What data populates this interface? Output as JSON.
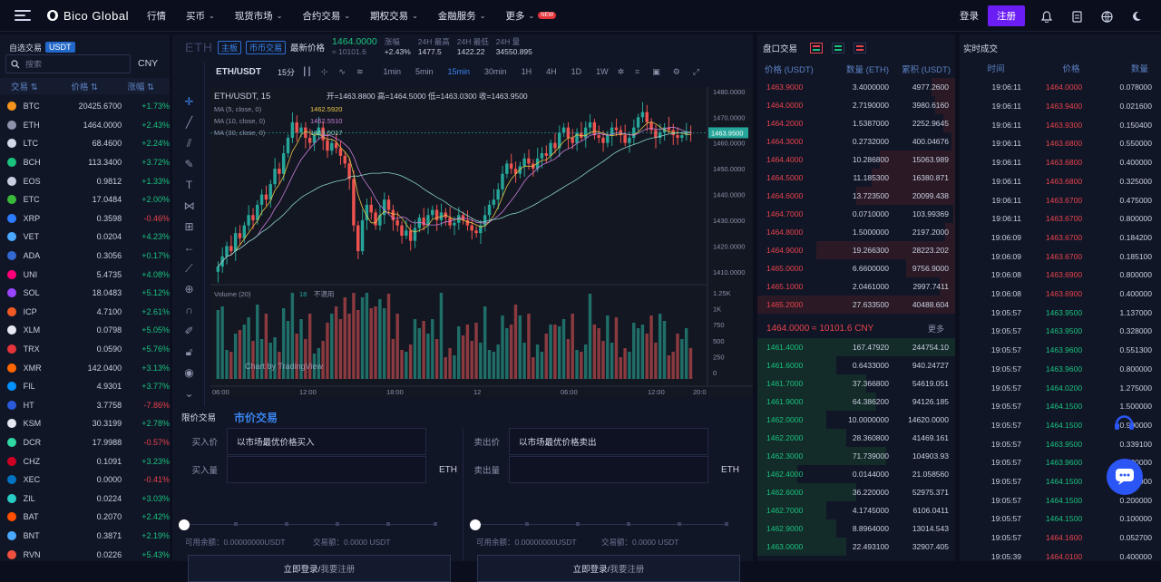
{
  "header": {
    "brand": "Bico Global",
    "nav": [
      {
        "label": "行情",
        "arrow": false,
        "new": false
      },
      {
        "label": "买币",
        "arrow": true,
        "new": false
      },
      {
        "label": "现货市场",
        "arrow": true,
        "new": false
      },
      {
        "label": "合约交易",
        "arrow": true,
        "new": false
      },
      {
        "label": "期权交易",
        "arrow": true,
        "new": false
      },
      {
        "label": "金融服务",
        "arrow": true,
        "new": false
      },
      {
        "label": "更多",
        "arrow": true,
        "new": true
      }
    ],
    "new_badge": "NEW",
    "login": "登录",
    "register": "注册"
  },
  "market": {
    "title": "自选交易",
    "tab": "USDT",
    "search_placeholder": "搜索",
    "currency": "CNY",
    "col_pair": "交易",
    "col_price": "价格",
    "col_change": "涨幅",
    "coins": [
      {
        "name": "BTC",
        "price": "20425.6700",
        "change": "+1.73%",
        "color": "#f7931a"
      },
      {
        "name": "ETH",
        "price": "1464.0000",
        "change": "+2.43%",
        "color": "#8c93ab"
      },
      {
        "name": "LTC",
        "price": "68.4600",
        "change": "+2.24%",
        "color": "#d3d9e9"
      },
      {
        "name": "BCH",
        "price": "113.3400",
        "change": "+3.72%",
        "color": "#19c37d"
      },
      {
        "name": "EOS",
        "price": "0.9812",
        "change": "+1.33%",
        "color": "#c9cfe0"
      },
      {
        "name": "ETC",
        "price": "17.0484",
        "change": "+2.00%",
        "color": "#3ab83a"
      },
      {
        "name": "XRP",
        "price": "0.3598",
        "change": "-0.46%",
        "color": "#2b7cff"
      },
      {
        "name": "VET",
        "price": "0.0204",
        "change": "+4.23%",
        "color": "#4aa8ff"
      },
      {
        "name": "ADA",
        "price": "0.3056",
        "change": "+0.17%",
        "color": "#3468d1"
      },
      {
        "name": "UNI",
        "price": "5.4735",
        "change": "+4.08%",
        "color": "#ff007a"
      },
      {
        "name": "SOL",
        "price": "18.0483",
        "change": "+5.12%",
        "color": "#9945ff"
      },
      {
        "name": "ICP",
        "price": "4.7100",
        "change": "+2.61%",
        "color": "#f15a24"
      },
      {
        "name": "XLM",
        "price": "0.0798",
        "change": "+5.05%",
        "color": "#e6e9f2"
      },
      {
        "name": "TRX",
        "price": "0.0590",
        "change": "+5.76%",
        "color": "#e5353a"
      },
      {
        "name": "XMR",
        "price": "142.0400",
        "change": "+3.13%",
        "color": "#ff6600"
      },
      {
        "name": "FIL",
        "price": "4.9301",
        "change": "+3.77%",
        "color": "#0090ff"
      },
      {
        "name": "HT",
        "price": "3.7758",
        "change": "-7.86%",
        "color": "#2a5ada"
      },
      {
        "name": "KSM",
        "price": "30.3199",
        "change": "+2.78%",
        "color": "#e6e9f2"
      },
      {
        "name": "DCR",
        "price": "17.9988",
        "change": "-0.57%",
        "color": "#2ed8a3"
      },
      {
        "name": "CHZ",
        "price": "0.1091",
        "change": "+3.23%",
        "color": "#cd0124"
      },
      {
        "name": "XEC",
        "price": "0.0000",
        "change": "-0.41%",
        "color": "#0074c2"
      },
      {
        "name": "ZIL",
        "price": "0.0224",
        "change": "+3.03%",
        "color": "#29ccc4"
      },
      {
        "name": "BAT",
        "price": "0.2070",
        "change": "+2.42%",
        "color": "#ff5000"
      },
      {
        "name": "BNT",
        "price": "0.3871",
        "change": "+2.19%",
        "color": "#4aa8ff"
      },
      {
        "name": "RVN",
        "price": "0.0226",
        "change": "+5.43%",
        "color": "#f0503e"
      }
    ]
  },
  "ticker": {
    "symbol": "ETH",
    "main_btn": "主板",
    "pair_btn": "币币交易",
    "latest_label": "最新价格",
    "latest_price": "1464.0000",
    "latest_cny": "≈ 10101.6",
    "change_label": "涨幅",
    "change": "+2.43%",
    "high_label": "24H 最高",
    "high": "1477.5",
    "low_label": "24H 最低",
    "low": "1422.22",
    "vol_label": "24H 量",
    "vol": "34550.895"
  },
  "chart_toolbar": {
    "pair": "ETH/USDT",
    "interval": "15分",
    "timeframes": [
      "1min",
      "5min",
      "15min",
      "30min",
      "1H",
      "4H",
      "1D",
      "1W"
    ],
    "active_timeframe": "15min"
  },
  "chart_data": {
    "type": "candlestick",
    "legend_pair": "ETH/USDT, 15",
    "ohlc": {
      "open": "开=1463.8800",
      "high": "高=1464.5000",
      "low": "低=1463.0300",
      "close": "收=1463.9500"
    },
    "ma_labels": [
      {
        "label": "MA (5, close, 0)",
        "value": "1462.5920",
        "color": "#e8c547"
      },
      {
        "label": "MA (10, close, 0)",
        "value": "1462.5510",
        "color": "#c77dd9"
      },
      {
        "label": "MA (30, close, 0)",
        "value": "1463.5017",
        "color": "#8ad4c6"
      }
    ],
    "current_price": "1463.9500",
    "y_ticks": [
      "1480.0000",
      "1470.0000",
      "1460.0000",
      "1450.0000",
      "1440.0000",
      "1430.0000",
      "1420.0000",
      "1410.0000"
    ],
    "ylim": [
      1405,
      1481
    ],
    "x_ticks": [
      "06:00",
      "12:00",
      "18:00",
      "12",
      "06:00",
      "12:00",
      "20:0"
    ],
    "volume_label": "Volume (20)",
    "volume_value": "18",
    "volume_na": "不適用",
    "vol_ticks": [
      "1.25K",
      "1K",
      "750",
      "500",
      "250",
      "0"
    ],
    "watermark": "Chart by TradingView",
    "closes": [
      1412,
      1416,
      1420,
      1418,
      1425,
      1423,
      1428,
      1432,
      1430,
      1436,
      1440,
      1438,
      1444,
      1450,
      1448,
      1456,
      1462,
      1468,
      1464,
      1466,
      1462,
      1460,
      1463,
      1466,
      1461,
      1457,
      1460,
      1458,
      1455,
      1452,
      1446,
      1428,
      1418,
      1430,
      1436,
      1433,
      1428,
      1432,
      1438,
      1434,
      1430,
      1428,
      1424,
      1426,
      1422,
      1427,
      1431,
      1428,
      1432,
      1434,
      1430,
      1433,
      1431,
      1428,
      1429,
      1432,
      1430,
      1428,
      1426,
      1425,
      1428,
      1432,
      1436,
      1438,
      1442,
      1448,
      1452,
      1450,
      1448,
      1451,
      1454,
      1452,
      1450,
      1454,
      1456,
      1455,
      1460,
      1458,
      1464,
      1466,
      1462,
      1460,
      1464,
      1462,
      1466,
      1468,
      1463,
      1462,
      1460,
      1463,
      1466,
      1465,
      1463,
      1460,
      1462,
      1466,
      1470,
      1472,
      1468,
      1465,
      1462,
      1464,
      1466,
      1465,
      1463,
      1462,
      1463,
      1464,
      1463.95
    ]
  },
  "order_form": {
    "tab_limit": "限价交易",
    "tab_market": "市价交易",
    "buy_price_label": "买入价",
    "buy_price_value": "以市场最优价格买入",
    "buy_qty_label": "买入量",
    "sell_price_label": "卖出价",
    "sell_price_value": "以市场最优价格卖出",
    "sell_qty_label": "卖出量",
    "unit": "ETH",
    "available": "可用余额：0.00000000USDT",
    "volume": "交易额：0.0000 USDT",
    "login_text": "立即登录/",
    "register_text": " 我要注册"
  },
  "orderbook": {
    "title": "盘口交易",
    "col_price": "价格 (USDT)",
    "col_amount": "数量 (ETH)",
    "col_total": "累积 (USDT)",
    "asks": [
      {
        "p": "1463.9000",
        "a": "3.4000000",
        "s": "4977.2600",
        "d": 0.12
      },
      {
        "p": "1464.0000",
        "a": "2.7190000",
        "s": "3980.6160",
        "d": 0.1
      },
      {
        "p": "1464.2000",
        "a": "1.5387000",
        "s": "2252.9645",
        "d": 0.06
      },
      {
        "p": "1464.3000",
        "a": "0.2732000",
        "s": "400.04676",
        "d": 0.02
      },
      {
        "p": "1464.4000",
        "a": "10.286800",
        "s": "15063.989",
        "d": 0.38
      },
      {
        "p": "1464.5000",
        "a": "11.185300",
        "s": "16380.871",
        "d": 0.42
      },
      {
        "p": "1464.6000",
        "a": "13.723500",
        "s": "20099.438",
        "d": 0.5
      },
      {
        "p": "1464.7000",
        "a": "0.0710000",
        "s": "103.99369",
        "d": 0.01
      },
      {
        "p": "1464.8000",
        "a": "1.5000000",
        "s": "2197.2000",
        "d": 0.05
      },
      {
        "p": "1464.9000",
        "a": "19.266300",
        "s": "28223.202",
        "d": 0.7
      },
      {
        "p": "1465.0000",
        "a": "6.6600000",
        "s": "9756.9000",
        "d": 0.25
      },
      {
        "p": "1465.1000",
        "a": "2.0461000",
        "s": "2997.7411",
        "d": 0.08
      },
      {
        "p": "1465.2000",
        "a": "27.633500",
        "s": "40488.604",
        "d": 1.0
      }
    ],
    "mid_price": "1464.0000 ≈ 10101.6 CNY",
    "more": "更多",
    "bids": [
      {
        "p": "1461.4000",
        "a": "167.47920",
        "s": "244754.10",
        "d": 1.0
      },
      {
        "p": "1461.6000",
        "a": "0.6433000",
        "s": "940.24727",
        "d": 0.4
      },
      {
        "p": "1461.7000",
        "a": "37.366800",
        "s": "54619.051",
        "d": 0.55
      },
      {
        "p": "1461.9000",
        "a": "64.386200",
        "s": "94126.185",
        "d": 0.6
      },
      {
        "p": "1462.0000",
        "a": "10.0000000",
        "s": "14620.0000",
        "d": 0.35
      },
      {
        "p": "1462.2000",
        "a": "28.360800",
        "s": "41469.161",
        "d": 0.45
      },
      {
        "p": "1462.3000",
        "a": "71.739000",
        "s": "104903.93",
        "d": 0.65
      },
      {
        "p": "1462.4000",
        "a": "0.0144000",
        "s": "21.058560",
        "d": 0.2
      },
      {
        "p": "1462.6000",
        "a": "36.220000",
        "s": "52975.371",
        "d": 0.5
      },
      {
        "p": "1462.7000",
        "a": "4.1745000",
        "s": "6106.0411",
        "d": 0.35
      },
      {
        "p": "1462.9000",
        "a": "8.8964000",
        "s": "13014.543",
        "d": 0.4
      },
      {
        "p": "1463.0000",
        "a": "22.493100",
        "s": "32907.405",
        "d": 0.45
      }
    ]
  },
  "trades": {
    "title": "实时成交",
    "col_time": "时间",
    "col_price": "价格",
    "col_amount": "数量",
    "rows": [
      {
        "t": "19:06:11",
        "p": "1464.0000",
        "a": "0.078000",
        "side": "dn"
      },
      {
        "t": "19:06:11",
        "p": "1463.9400",
        "a": "0.021600",
        "side": "dn"
      },
      {
        "t": "19:06:11",
        "p": "1463.9300",
        "a": "0.150400",
        "side": "dn"
      },
      {
        "t": "19:06:11",
        "p": "1463.6800",
        "a": "0.550000",
        "side": "dn"
      },
      {
        "t": "19:06:11",
        "p": "1463.6800",
        "a": "0.400000",
        "side": "dn"
      },
      {
        "t": "19:06:11",
        "p": "1463.6800",
        "a": "0.325000",
        "side": "dn"
      },
      {
        "t": "19:06:11",
        "p": "1463.6700",
        "a": "0.475000",
        "side": "dn"
      },
      {
        "t": "19:06:11",
        "p": "1463.6700",
        "a": "0.800000",
        "side": "dn"
      },
      {
        "t": "19:06:09",
        "p": "1463.6700",
        "a": "0.184200",
        "side": "dn"
      },
      {
        "t": "19:06:09",
        "p": "1463.6700",
        "a": "0.185100",
        "side": "dn"
      },
      {
        "t": "19:06:08",
        "p": "1463.6900",
        "a": "0.800000",
        "side": "dn"
      },
      {
        "t": "19:06:08",
        "p": "1463.6900",
        "a": "0.400000",
        "side": "dn"
      },
      {
        "t": "19:05:57",
        "p": "1463.9500",
        "a": "1.137000",
        "side": "up"
      },
      {
        "t": "19:05:57",
        "p": "1463.9500",
        "a": "0.328000",
        "side": "up"
      },
      {
        "t": "19:05:57",
        "p": "1463.9600",
        "a": "0.551300",
        "side": "up"
      },
      {
        "t": "19:05:57",
        "p": "1463.9600",
        "a": "0.800000",
        "side": "up"
      },
      {
        "t": "19:05:57",
        "p": "1464.0200",
        "a": "1.275000",
        "side": "up"
      },
      {
        "t": "19:05:57",
        "p": "1464.1500",
        "a": "1.500000",
        "side": "up"
      },
      {
        "t": "19:05:57",
        "p": "1464.1500",
        "a": "0.900000",
        "side": "up"
      },
      {
        "t": "19:05:57",
        "p": "1463.9500",
        "a": "0.339100",
        "side": "up"
      },
      {
        "t": "19:05:57",
        "p": "1463.9600",
        "a": "0.100000",
        "side": "up"
      },
      {
        "t": "19:05:57",
        "p": "1464.1500",
        "a": "0.100000",
        "side": "up"
      },
      {
        "t": "19:05:57",
        "p": "1464.1500",
        "a": "0.200000",
        "side": "up"
      },
      {
        "t": "19:05:57",
        "p": "1464.1500",
        "a": "0.100000",
        "side": "up"
      },
      {
        "t": "19:05:57",
        "p": "1464.1600",
        "a": "0.052700",
        "side": "dn"
      },
      {
        "t": "19:05:39",
        "p": "1464.0100",
        "a": "0.400000",
        "side": "dn"
      }
    ]
  }
}
